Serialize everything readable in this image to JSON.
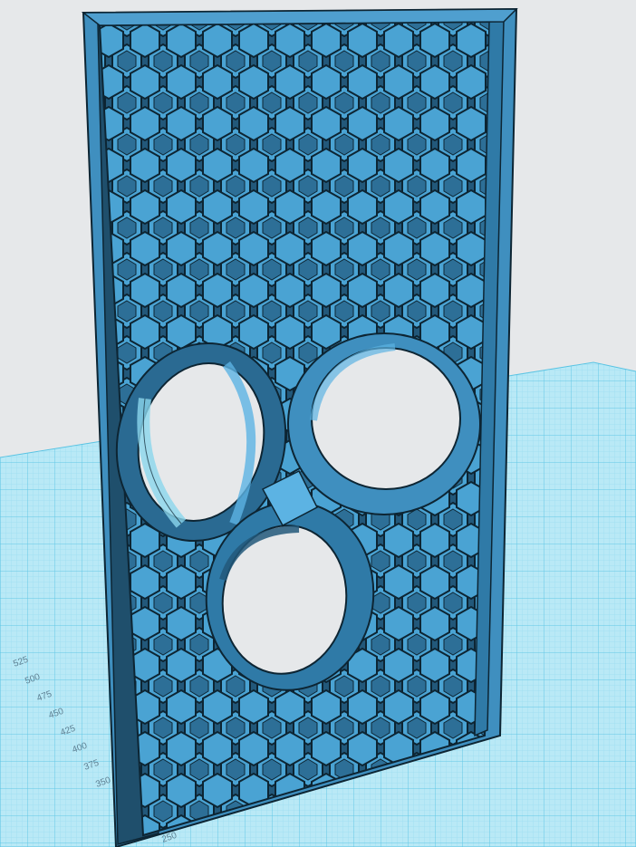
{
  "viewport": {
    "background": "#e6e8ea",
    "grid_color": "#58c3e3",
    "grid_minor_color": "#8bd6ec",
    "grid_fill": "#b9e9f6"
  },
  "model": {
    "color": "#3f8fbf",
    "dark_color": "#245e82",
    "light_color": "#5cb3e3",
    "edge_color": "#0d2533",
    "pattern": "honeycomb",
    "cutouts": 3
  },
  "axis_labels": [
    "525",
    "500",
    "475",
    "450",
    "425",
    "400",
    "375",
    "350"
  ],
  "bottom_label": "250"
}
